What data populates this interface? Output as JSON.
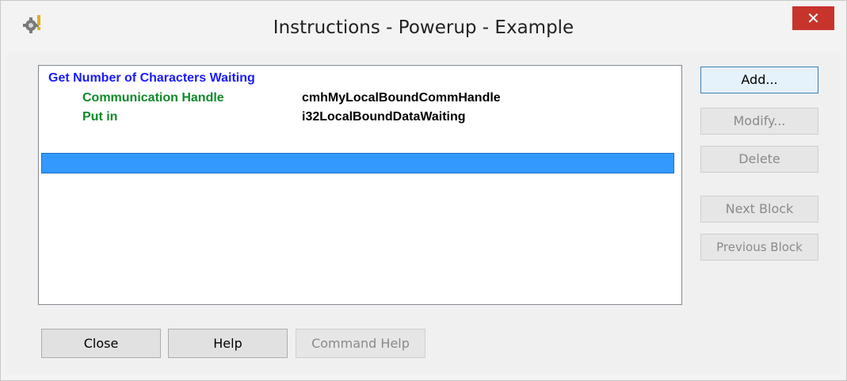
{
  "window": {
    "title": "Instructions - Powerup - Example",
    "close_glyph": "✕",
    "app_icon": "app-gear-icon"
  },
  "instructions": {
    "command": "Get Number of Characters Waiting",
    "params": [
      {
        "label": "Communication Handle",
        "value": "cmhMyLocalBoundCommHandle"
      },
      {
        "label": "Put in",
        "value": "i32LocalBoundDataWaiting"
      }
    ]
  },
  "side_buttons": {
    "add": "Add...",
    "modify": "Modify...",
    "delete": "Delete",
    "next_block": "Next Block",
    "previous_block": "Previous Block"
  },
  "bottom_buttons": {
    "close": "Close",
    "help": "Help",
    "command_help": "Command Help"
  },
  "colors": {
    "command": "#1a1aff",
    "param_label": "#0f8a28",
    "selection": "#3399ff",
    "close_button": "#c7342c"
  }
}
